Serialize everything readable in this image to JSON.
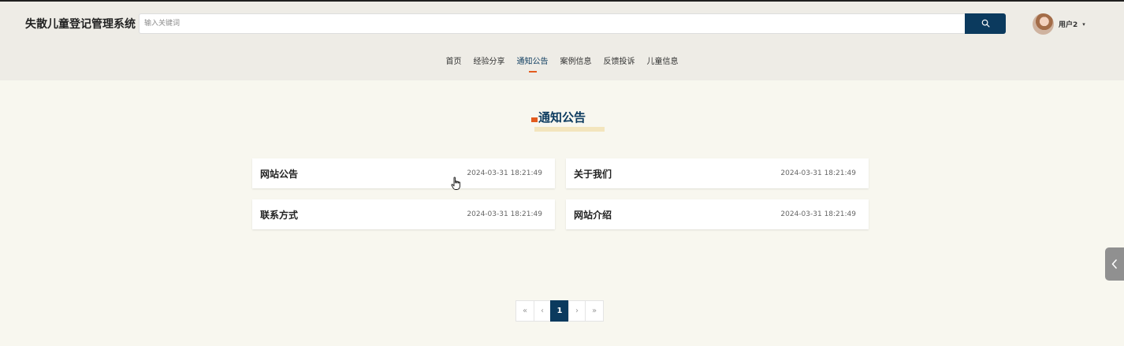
{
  "header": {
    "brand": "失散儿童登记管理系统",
    "search_placeholder": "输入关键词",
    "search_icon": "search-icon",
    "user_name": "用户2",
    "user_caret": "▾"
  },
  "nav": {
    "items": [
      {
        "label": "首页"
      },
      {
        "label": "经验分享"
      },
      {
        "label": "通知公告"
      },
      {
        "label": "案例信息"
      },
      {
        "label": "反馈投诉"
      },
      {
        "label": "儿童信息"
      }
    ],
    "active_index": 2
  },
  "section": {
    "title": "通知公告"
  },
  "notices": [
    {
      "title": "网站公告",
      "date": "2024-03-31 18:21:49"
    },
    {
      "title": "关于我们",
      "date": "2024-03-31 18:21:49"
    },
    {
      "title": "联系方式",
      "date": "2024-03-31 18:21:49"
    },
    {
      "title": "网站介绍",
      "date": "2024-03-31 18:21:49"
    }
  ],
  "pagination": {
    "first": "«",
    "prev": "‹",
    "current": "1",
    "next": "›",
    "last": "»"
  },
  "side_tab": {
    "icon": "chevron-left-icon"
  },
  "colors": {
    "primary": "#0b3a5e",
    "accent": "#e35b1e",
    "page_bg": "#f8f7ef",
    "header_bg": "#eeece6"
  }
}
